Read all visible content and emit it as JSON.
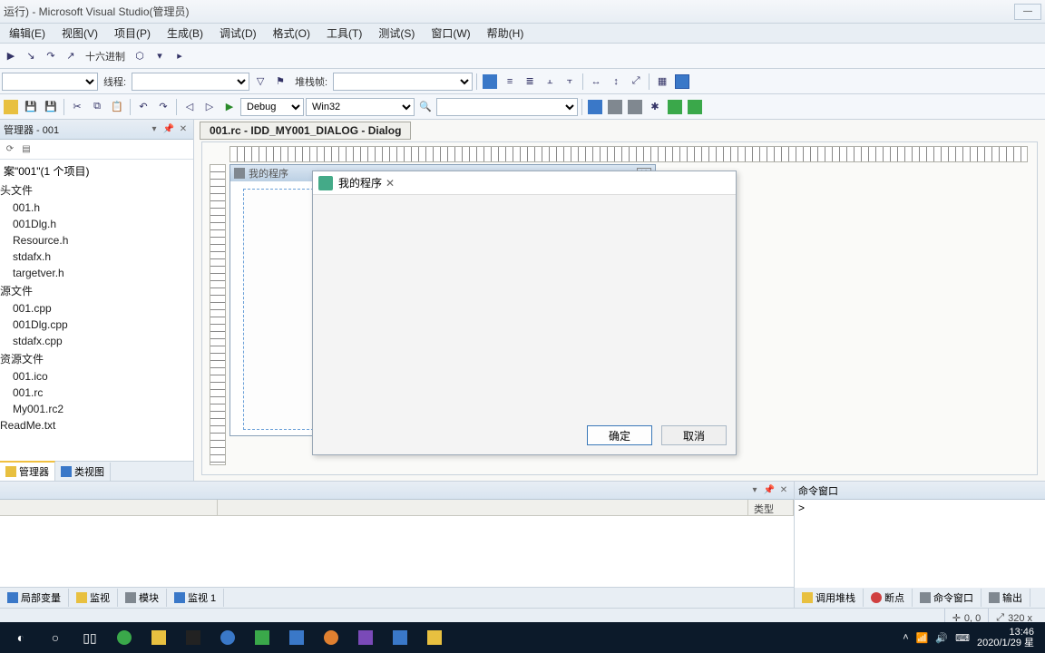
{
  "title_suffix": "运行) - Microsoft Visual Studio(管理员)",
  "menus": [
    "编辑(E)",
    "视图(V)",
    "项目(P)",
    "生成(B)",
    "调试(D)",
    "格式(O)",
    "工具(T)",
    "测试(S)",
    "窗口(W)",
    "帮助(H)"
  ],
  "toolbar1": {
    "hex_label": "十六进制"
  },
  "toolbar2": {
    "thread_label": "线程:",
    "stackframe_label": "堆栈帧:"
  },
  "toolbar3": {
    "config": "Debug",
    "platform": "Win32"
  },
  "solution_panel": {
    "title_suffix": "管理器 - 001",
    "root": "案\"001\"(1 个项目)",
    "groups": [
      {
        "label": "头文件",
        "items": [
          "001.h",
          "001Dlg.h",
          "Resource.h",
          "stdafx.h",
          "targetver.h"
        ]
      },
      {
        "label": "源文件",
        "items": [
          "001.cpp",
          "001Dlg.cpp",
          "stdafx.cpp"
        ]
      },
      {
        "label": "资源文件",
        "items": [
          "001.ico",
          "001.rc",
          "My001.rc2"
        ]
      }
    ],
    "loose_items": [
      "ReadMe.txt"
    ],
    "tabs": [
      {
        "label": "管理器",
        "icon": "solution-icon"
      },
      {
        "label": "类视图",
        "icon": "class-view-icon"
      }
    ]
  },
  "editor": {
    "doc_tab": "001.rc - IDD_MY001_DIALOG - Dialog",
    "design_dialog_title": "我的程序"
  },
  "runtime_dialog": {
    "title": "我的程序",
    "ok": "确定",
    "cancel": "取消"
  },
  "bottom": {
    "left_header": "",
    "grid_cols": [
      "",
      "类型"
    ],
    "left_tabs": [
      "局部变量",
      "监视",
      "模块",
      "监视 1"
    ],
    "right_header": "命令窗口",
    "right_prompt": ">",
    "right_tabs": [
      "调用堆栈",
      "断点",
      "命令窗口",
      "输出"
    ]
  },
  "statusbar": {
    "coord": "0, 0",
    "size_prefix": "320 x"
  },
  "taskbar": {
    "time": "13:46",
    "date": "2020/1/29 星"
  }
}
